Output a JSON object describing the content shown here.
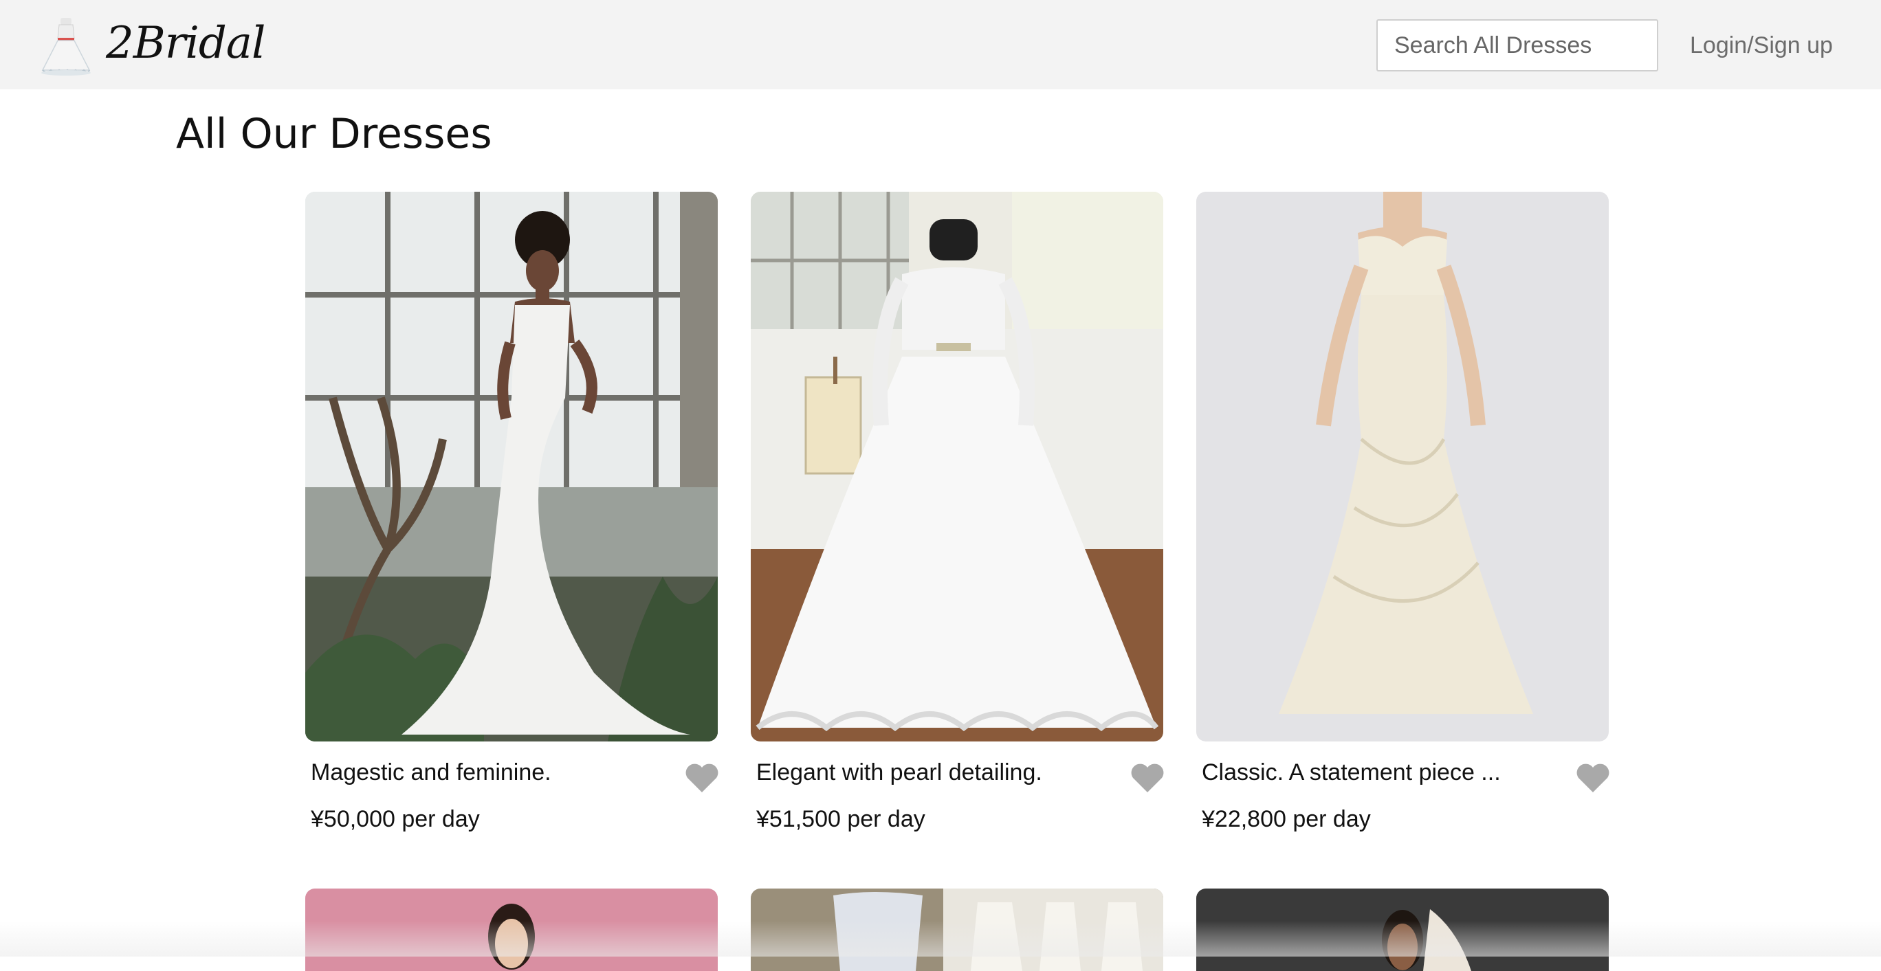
{
  "header": {
    "brand": "2Bridal",
    "search_placeholder": "Search All Dresses",
    "login_label": "Login/Sign up"
  },
  "main": {
    "title": "All Our Dresses",
    "dresses": [
      {
        "name": "Magestic and feminine.",
        "price": "¥50,000 per day",
        "liked": false
      },
      {
        "name": "Elegant with pearl detailing.",
        "price": "¥51,500 per day",
        "liked": false
      },
      {
        "name": "Classic. A statement piece ...",
        "price": "¥22,800 per day",
        "liked": false
      }
    ]
  },
  "icons": {
    "logo": "dress-icon",
    "favorite": "heart-icon"
  },
  "colors": {
    "header_bg": "#f3f3f3",
    "heart": "#a9a9a9",
    "login_text": "#6b6b6b"
  }
}
